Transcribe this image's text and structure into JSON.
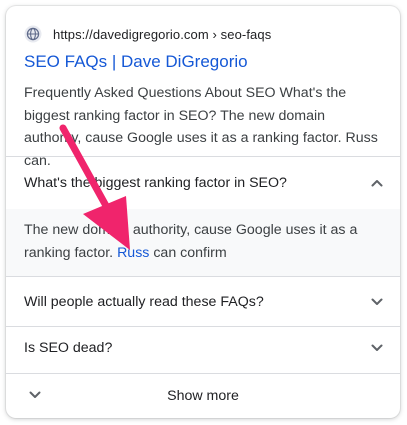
{
  "result": {
    "url": "https://davedigregorio.com › seo-faqs",
    "title": "SEO FAQs | Dave DiGregorio",
    "snippet": "Frequently Asked Questions About SEO What's the biggest ranking factor in SEO? The new domain authority, cause Google uses it as a ranking factor. Russ can."
  },
  "faq": {
    "items": [
      {
        "question": "What's the biggest ranking factor in SEO?",
        "expanded": true,
        "answer_before": "The new domain authority, cause Google uses it as a ranking factor. ",
        "answer_link": "Russ",
        "answer_after": " can confirm"
      },
      {
        "question": "Will people actually read these FAQs?",
        "expanded": false
      },
      {
        "question": "Is SEO dead?",
        "expanded": false
      }
    ],
    "show_more_label": "Show more"
  },
  "icons": {
    "site": "globe-icon",
    "collapse": "chevron-up-icon",
    "expand": "chevron-down-icon",
    "annotation": "pink-arrow-annotation"
  },
  "colors": {
    "link": "#1558d6",
    "text": "#202124",
    "muted": "#3c4043",
    "divider": "#dadce0",
    "answer_bg": "#f8f9fa",
    "arrow": "#f0246c"
  }
}
